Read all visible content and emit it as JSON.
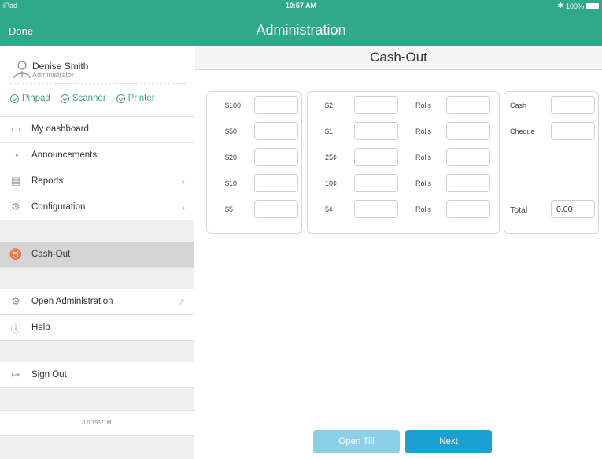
{
  "status_bar": {
    "device": "iPad",
    "time": "10:57 AM",
    "battery": "100%"
  },
  "nav": {
    "done_label": "Done",
    "title": "Administration"
  },
  "user": {
    "name": "Denise Smith",
    "role": "Administrator"
  },
  "devices": [
    {
      "label": "Pinpad",
      "status": "ok"
    },
    {
      "label": "Scanner",
      "status": "ok"
    },
    {
      "label": "Printer",
      "status": "ok"
    }
  ],
  "menu": {
    "dashboard": "My dashboard",
    "announcements": "Announcements",
    "reports": "Reports",
    "configuration": "Configuration",
    "cashout": "Cash-Out",
    "open_admin": "Open Administration",
    "help": "Help",
    "sign_out": "Sign Out"
  },
  "version": "0.0.19621M",
  "page_title": "Cash-Out",
  "bills": [
    {
      "label": "$100",
      "value": ""
    },
    {
      "label": "$50",
      "value": ""
    },
    {
      "label": "$20",
      "value": ""
    },
    {
      "label": "$10",
      "value": ""
    },
    {
      "label": "$5",
      "value": ""
    }
  ],
  "coins": [
    {
      "label": "$2",
      "value": "",
      "rolls_label": "Rolls",
      "rolls_value": ""
    },
    {
      "label": "$1",
      "value": "",
      "rolls_label": "Rolls",
      "rolls_value": ""
    },
    {
      "label": "25¢",
      "value": "",
      "rolls_label": "Rolls",
      "rolls_value": ""
    },
    {
      "label": "10¢",
      "value": "",
      "rolls_label": "Rolls",
      "rolls_value": ""
    },
    {
      "label": "5¢",
      "value": "",
      "rolls_label": "Rolls",
      "rolls_value": ""
    }
  ],
  "summary": {
    "cash_label": "Cash",
    "cash_value": "",
    "cheque_label": "Cheque",
    "cheque_value": "",
    "total_label": "Total",
    "total_value": "0.00"
  },
  "buttons": {
    "open_till": "Open Till",
    "next": "Next"
  },
  "colors": {
    "header": "#2fa88c",
    "accent": "#1c9fd2",
    "accent_disabled": "#8bd0e6",
    "ok": "#3aa57f"
  }
}
